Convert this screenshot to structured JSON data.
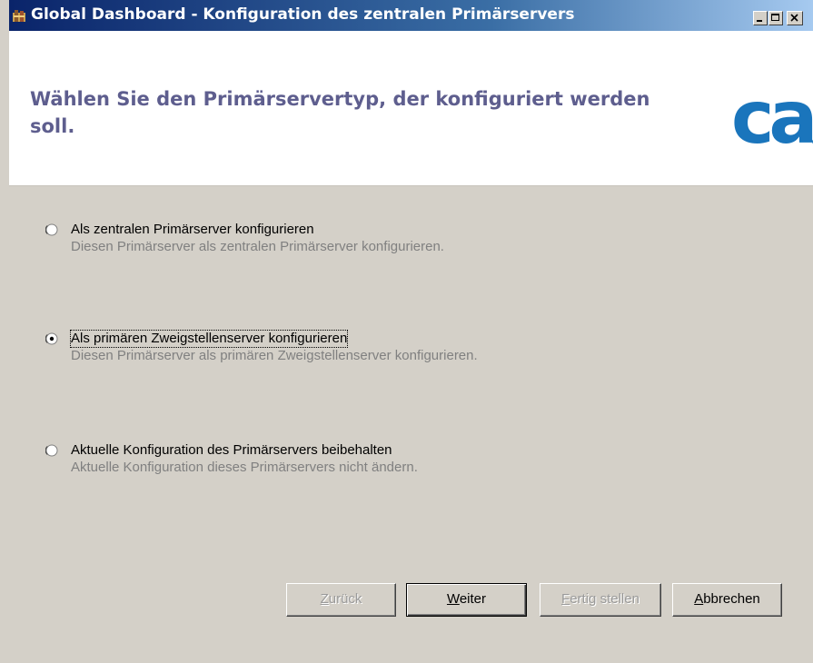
{
  "window": {
    "title": "Global Dashboard - Konfiguration des zentralen Primärservers",
    "icon": "app-icon"
  },
  "header": {
    "heading": "Wählen Sie den Primärservertyp, der konfiguriert werden soll.",
    "logo_text": "ca",
    "logo_color": "#1a75bc",
    "heading_color": "#5e5e8e"
  },
  "options": [
    {
      "label": "Als zentralen Primärserver konfigurieren",
      "description": "Diesen Primärserver als zentralen Primärserver konfigurieren.",
      "selected": false
    },
    {
      "label": "Als primären Zweigstellenserver konfigurieren",
      "description": "Diesen Primärserver als primären Zweigstellenserver konfigurieren.",
      "selected": true
    },
    {
      "label": "Aktuelle Konfiguration des Primärservers beibehalten",
      "description": "Aktuelle Konfiguration dieses Primärservers nicht ändern.",
      "selected": false
    }
  ],
  "buttons": {
    "back": {
      "first": "Z",
      "rest": "urück",
      "enabled": false
    },
    "next": {
      "first": "W",
      "rest": "eiter",
      "enabled": true
    },
    "finish": {
      "first": "F",
      "rest": "ertig stellen",
      "enabled": false
    },
    "cancel": {
      "first": "A",
      "rest": "bbrechen",
      "enabled": true
    }
  }
}
